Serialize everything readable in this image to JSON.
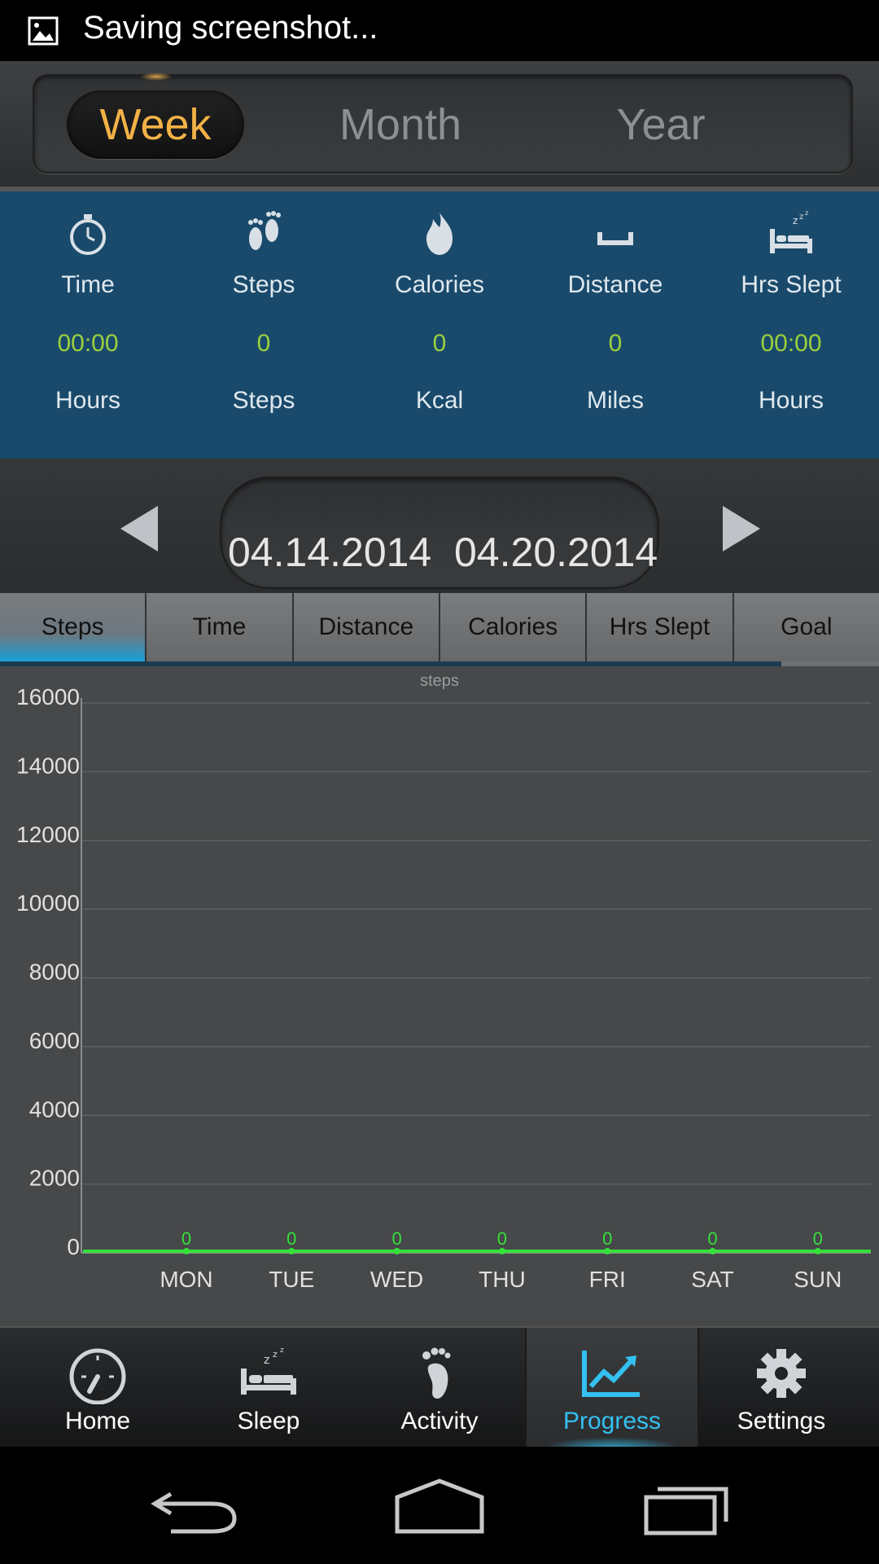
{
  "status_bar": {
    "text": "Saving screenshot...",
    "icon": "image-icon"
  },
  "period_tabs": {
    "items": [
      "Week",
      "Month",
      "Year"
    ],
    "selected": "Week"
  },
  "stats": [
    {
      "icon": "stopwatch-icon",
      "label": "Time",
      "value": "00:00",
      "unit": "Hours"
    },
    {
      "icon": "footprints-icon",
      "label": "Steps",
      "value": "0",
      "unit": "Steps"
    },
    {
      "icon": "flame-icon",
      "label": "Calories",
      "value": "0",
      "unit": "Kcal"
    },
    {
      "icon": "distance-icon",
      "label": "Distance",
      "value": "0",
      "unit": "Miles"
    },
    {
      "icon": "bed-icon",
      "label": "Hrs Slept",
      "value": "00:00",
      "unit": "Hours"
    }
  ],
  "date_range": {
    "start": "04.14.2014",
    "end": "04.20.2014"
  },
  "metric_tabs": {
    "items": [
      "Steps",
      "Time",
      "Distance",
      "Calories",
      "Hrs Slept",
      "Goal"
    ],
    "selected": "Steps"
  },
  "chart_data": {
    "type": "line",
    "title": "steps",
    "categories": [
      "MON",
      "TUE",
      "WED",
      "THU",
      "FRI",
      "SAT",
      "SUN"
    ],
    "values": [
      0,
      0,
      0,
      0,
      0,
      0,
      0
    ],
    "ylim": [
      0,
      16000
    ],
    "yticks": [
      0,
      2000,
      4000,
      6000,
      8000,
      10000,
      12000,
      14000,
      16000
    ],
    "grid": true,
    "line_color": "#35e03a"
  },
  "bottom_nav": {
    "items": [
      {
        "label": "Home",
        "icon": "speedometer-icon"
      },
      {
        "label": "Sleep",
        "icon": "bed-icon"
      },
      {
        "label": "Activity",
        "icon": "footprint-icon"
      },
      {
        "label": "Progress",
        "icon": "trend-chart-icon"
      },
      {
        "label": "Settings",
        "icon": "gear-icon"
      }
    ],
    "selected": "Progress"
  },
  "system_nav": {
    "back": "back-icon",
    "home": "home-icon",
    "recents": "recents-icon"
  },
  "colors": {
    "accent": "#34c0f0",
    "highlight": "#f3b247",
    "value": "#9cd03d",
    "panel": "#1a4a6b"
  }
}
